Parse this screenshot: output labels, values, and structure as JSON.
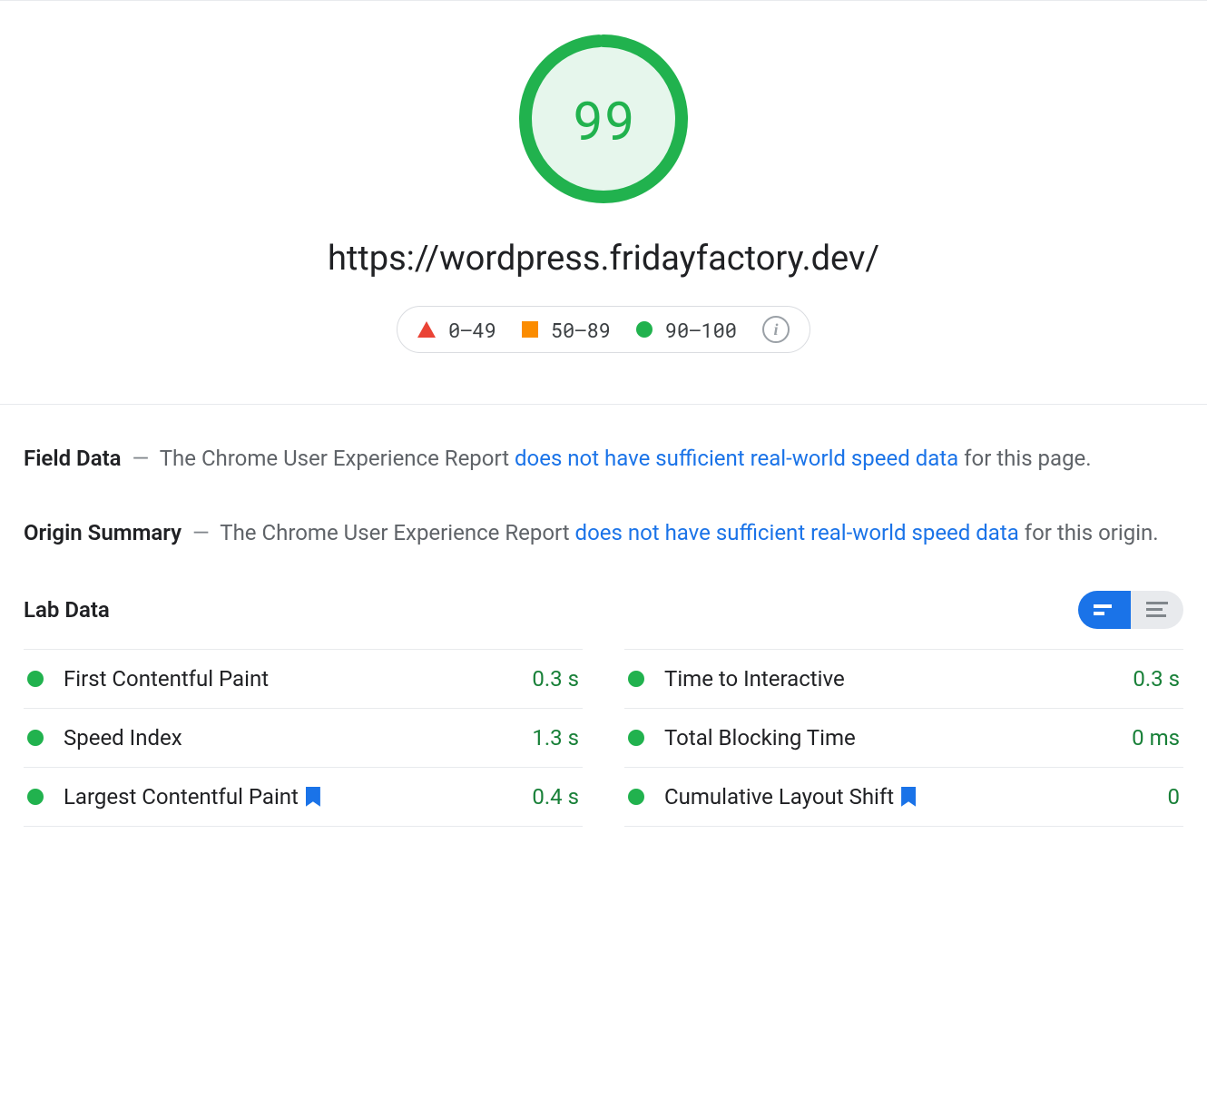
{
  "score": {
    "value": "99",
    "percent": 99,
    "color": "#21b24e",
    "fill": "#e6f6ec"
  },
  "url": "https://wordpress.fridayfactory.dev/",
  "legend": {
    "poor": "0–49",
    "avg": "50–89",
    "good": "90–100"
  },
  "field_data": {
    "heading": "Field Data",
    "prefix": "The Chrome User Experience Report ",
    "link": "does not have sufficient real-world speed data",
    "suffix": " for this page."
  },
  "origin_summary": {
    "heading": "Origin Summary",
    "prefix": "The Chrome User Experience Report ",
    "link": "does not have sufficient real-world speed data",
    "suffix": " for this origin."
  },
  "lab": {
    "heading": "Lab Data",
    "left": [
      {
        "label": "First Contentful Paint",
        "value": "0.3 s",
        "bookmark": false
      },
      {
        "label": "Speed Index",
        "value": "1.3 s",
        "bookmark": false
      },
      {
        "label": "Largest Contentful Paint",
        "value": "0.4 s",
        "bookmark": true
      }
    ],
    "right": [
      {
        "label": "Time to Interactive",
        "value": "0.3 s",
        "bookmark": false
      },
      {
        "label": "Total Blocking Time",
        "value": "0 ms",
        "bookmark": false
      },
      {
        "label": "Cumulative Layout Shift",
        "value": "0",
        "bookmark": true
      }
    ]
  }
}
